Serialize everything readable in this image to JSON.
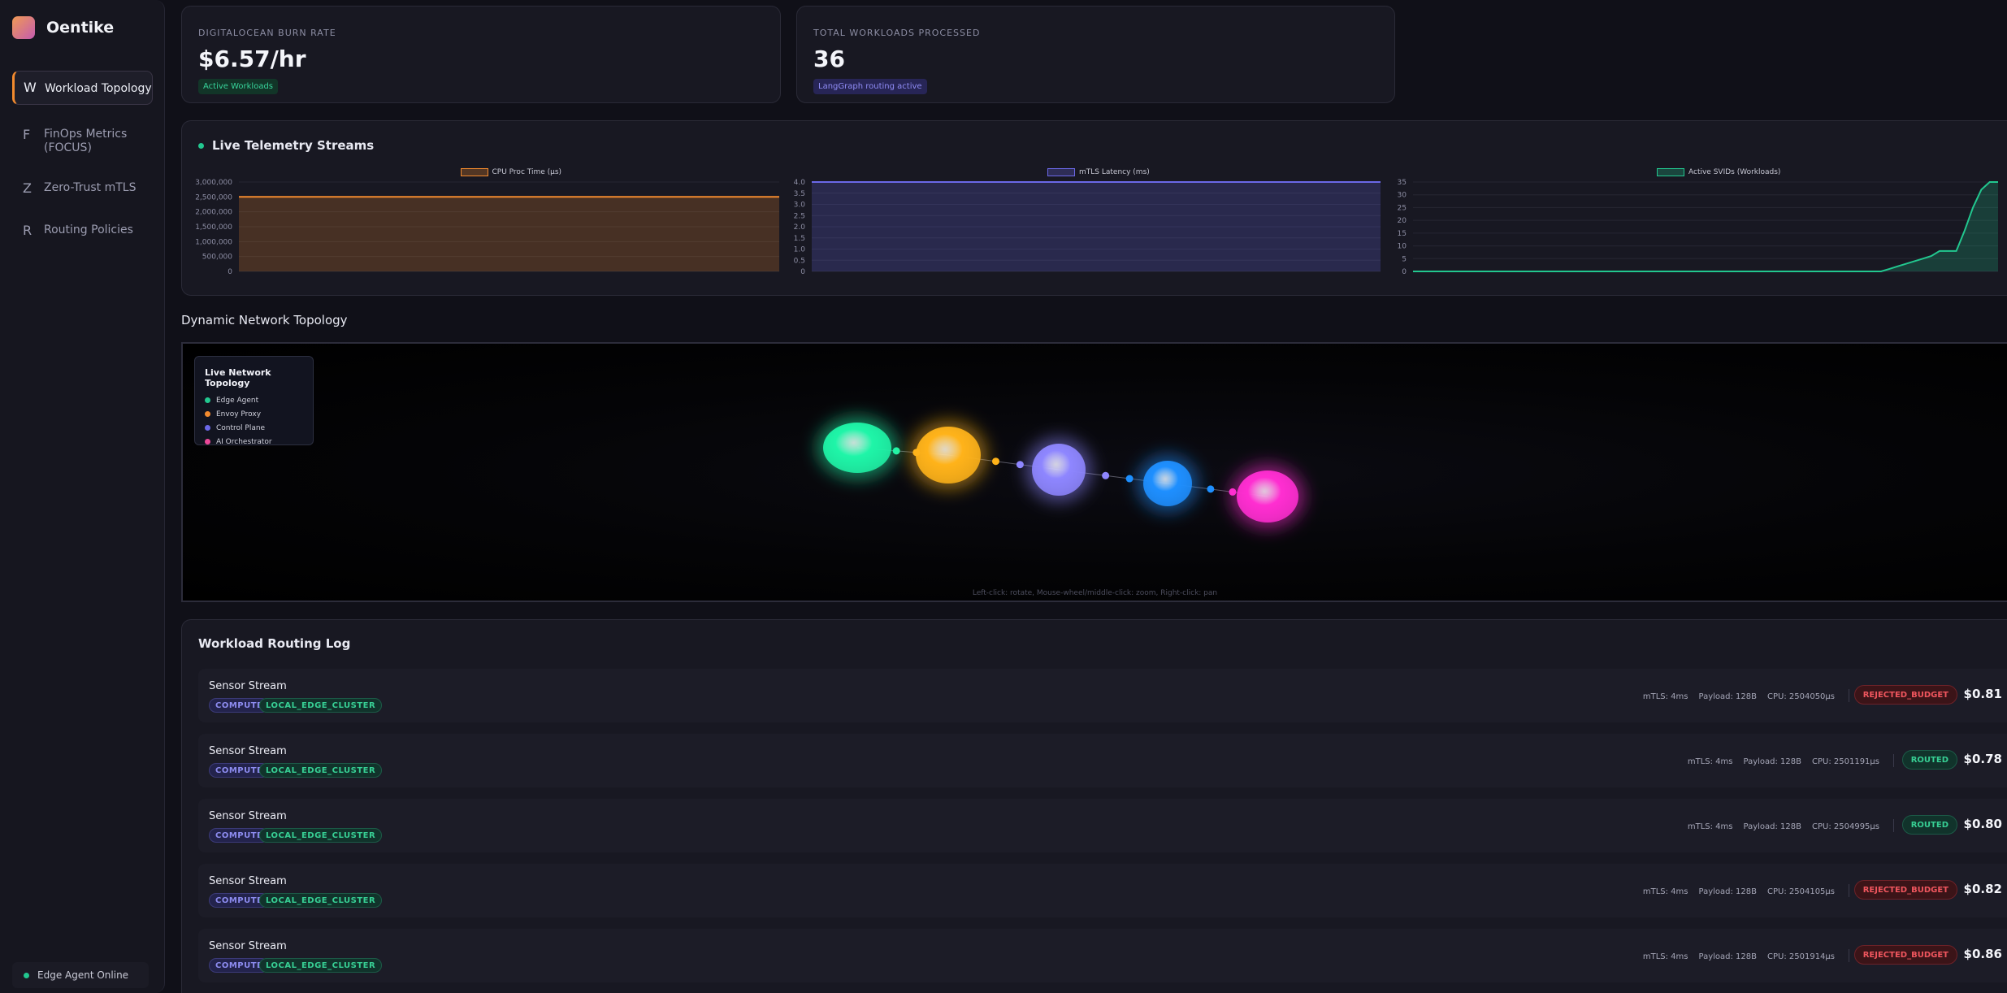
{
  "app": {
    "name": "Oentike"
  },
  "sidebar": {
    "items": [
      {
        "letter": "W",
        "label": "Workload Topology",
        "active": true
      },
      {
        "letter": "F",
        "label": "FinOps Metrics (FOCUS)",
        "active": false
      },
      {
        "letter": "Z",
        "label": "Zero-Trust mTLS",
        "active": false
      },
      {
        "letter": "R",
        "label": "Routing Policies",
        "active": false
      }
    ],
    "status": "Edge Agent Online"
  },
  "kpis": [
    {
      "label": "DIGITALOCEAN BURN RATE",
      "value": "$6.57/hr",
      "badge": "Active Workloads"
    },
    {
      "label": "TOTAL WORKLOADS PROCESSED",
      "value": "36",
      "badge": "LangGraph routing active"
    }
  ],
  "telemetry": {
    "title": "Live Telemetry Streams"
  },
  "chart_data": [
    {
      "type": "area",
      "series": [
        {
          "name": "CPU Proc Time (μs)",
          "values": [
            2500000,
            2500000
          ]
        }
      ],
      "color": "#f28a2e",
      "ylim": [
        0,
        3000000
      ],
      "yticks": [
        "3,000,000",
        "2,500,000",
        "2,000,000",
        "1,500,000",
        "1,000,000",
        "500,000",
        "0"
      ],
      "grid": true,
      "legend": "top-center"
    },
    {
      "type": "area",
      "series": [
        {
          "name": "mTLS Latency (ms)",
          "values": [
            4,
            4
          ]
        }
      ],
      "color": "#6b68e8",
      "ylim": [
        0,
        4
      ],
      "yticks": [
        "4.0",
        "3.5",
        "3.0",
        "2.5",
        "2.0",
        "1.5",
        "1.0",
        "0.5",
        "0"
      ],
      "grid": true,
      "legend": "top-center"
    },
    {
      "type": "area",
      "series": [
        {
          "name": "Active SVIDs (Workloads)",
          "values": [
            0,
            0,
            0,
            0,
            0,
            0,
            0,
            0,
            0,
            0,
            0,
            0,
            0,
            0,
            0,
            0,
            0,
            0,
            0,
            0,
            0,
            0,
            0,
            0,
            0,
            0,
            0,
            0,
            0,
            0,
            0,
            0,
            0,
            0,
            0,
            0,
            0,
            0,
            0,
            0,
            0,
            0,
            0,
            0,
            0,
            0,
            0,
            0,
            0,
            0,
            0,
            0,
            0,
            0,
            0,
            0,
            0,
            1,
            2,
            3,
            4,
            5,
            6,
            8,
            8,
            8,
            16,
            25,
            32,
            35,
            35
          ]
        }
      ],
      "color": "#22c78f",
      "ylim": [
        0,
        35
      ],
      "yticks": [
        "35",
        "30",
        "25",
        "20",
        "15",
        "10",
        "5",
        "0"
      ],
      "grid": true,
      "legend": "top-center"
    }
  ],
  "topology": {
    "title": "Dynamic Network Topology",
    "legend_title": "Live Network Topology",
    "legend": [
      {
        "label": "Edge Agent",
        "color": "#22c78f"
      },
      {
        "label": "Envoy Proxy",
        "color": "#f28a2e"
      },
      {
        "label": "Control Plane",
        "color": "#6b68e8"
      },
      {
        "label": "AI Orchestrator",
        "color": "#ec4899"
      }
    ],
    "nodes": [
      {
        "role": "Edge Agent",
        "color": "#1ff5a8"
      },
      {
        "role": "Envoy Proxy",
        "color": "#ffb31a"
      },
      {
        "role": "Control Plane",
        "color": "#8e86ff"
      },
      {
        "role": "Control Plane",
        "color": "#1e8fff"
      },
      {
        "role": "AI Orchestrator",
        "color": "#ff2ed1"
      }
    ],
    "hint": "Left-click: rotate, Mouse-wheel/middle-click: zoom, Right-click: pan"
  },
  "log": {
    "title": "Workload Routing Log",
    "rows": [
      {
        "name": "Sensor Stream",
        "tags": [
          "COMPUTE",
          "LOCAL_EDGE_CLUSTER"
        ],
        "mtls": "mTLS: 4ms",
        "payload": "Payload: 128B",
        "cpu": "CPU: 2504050μs",
        "status": "REJECTED_BUDGET",
        "cost": "$0.81"
      },
      {
        "name": "Sensor Stream",
        "tags": [
          "COMPUTE",
          "LOCAL_EDGE_CLUSTER"
        ],
        "mtls": "mTLS: 4ms",
        "payload": "Payload: 128B",
        "cpu": "CPU: 2501191μs",
        "status": "ROUTED",
        "cost": "$0.78"
      },
      {
        "name": "Sensor Stream",
        "tags": [
          "COMPUTE",
          "LOCAL_EDGE_CLUSTER"
        ],
        "mtls": "mTLS: 4ms",
        "payload": "Payload: 128B",
        "cpu": "CPU: 2504995μs",
        "status": "ROUTED",
        "cost": "$0.80"
      },
      {
        "name": "Sensor Stream",
        "tags": [
          "COMPUTE",
          "LOCAL_EDGE_CLUSTER"
        ],
        "mtls": "mTLS: 4ms",
        "payload": "Payload: 128B",
        "cpu": "CPU: 2504105μs",
        "status": "REJECTED_BUDGET",
        "cost": "$0.82"
      },
      {
        "name": "Sensor Stream",
        "tags": [
          "COMPUTE",
          "LOCAL_EDGE_CLUSTER"
        ],
        "mtls": "mTLS: 4ms",
        "payload": "Payload: 128B",
        "cpu": "CPU: 2501914μs",
        "status": "REJECTED_BUDGET",
        "cost": "$0.86"
      }
    ]
  }
}
